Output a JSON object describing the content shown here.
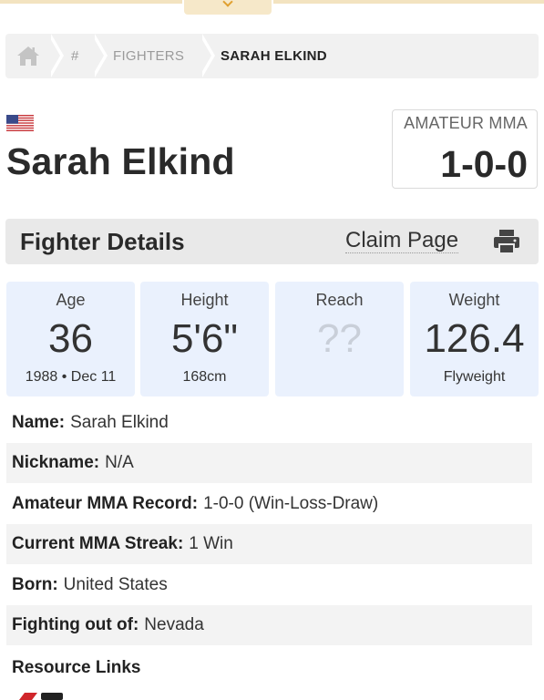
{
  "breadcrumb": {
    "items": [
      {
        "label": "",
        "icon": "home-icon"
      },
      {
        "label": "#"
      },
      {
        "label": "FIGHTERS"
      },
      {
        "label": "SARAH ELKIND"
      }
    ]
  },
  "fighter": {
    "name": "Sarah Elkind",
    "flag_icon": "us-flag-icon",
    "record_label": "AMATEUR MMA",
    "record_value": "1-0-0"
  },
  "details_bar": {
    "title": "Fighter Details",
    "claim_label": "Claim Page",
    "print_icon": "printer-icon"
  },
  "stats": [
    {
      "label": "Age",
      "value": "36",
      "sub": "1988 • Dec 11"
    },
    {
      "label": "Height",
      "value": "5'6\"",
      "sub": "168cm"
    },
    {
      "label": "Reach",
      "value": "??",
      "sub": ""
    },
    {
      "label": "Weight",
      "value": "126.4",
      "sub": "Flyweight"
    }
  ],
  "info_rows": [
    {
      "key": "Name:",
      "value": "Sarah Elkind"
    },
    {
      "key": "Nickname:",
      "value": "N/A"
    },
    {
      "key": "Amateur MMA Record:",
      "value": "1-0-0 (Win-Loss-Draw)"
    },
    {
      "key": "Current MMA Streak:",
      "value": "1 Win"
    },
    {
      "key": "Born:",
      "value": "United States"
    },
    {
      "key": "Fighting out of:",
      "value": "Nevada"
    }
  ],
  "resources": {
    "heading": "Resource Links"
  },
  "colors": {
    "accent": "#e0a030",
    "card_bg": "#eaf1fd",
    "bar_bg": "#e9e9e9"
  }
}
